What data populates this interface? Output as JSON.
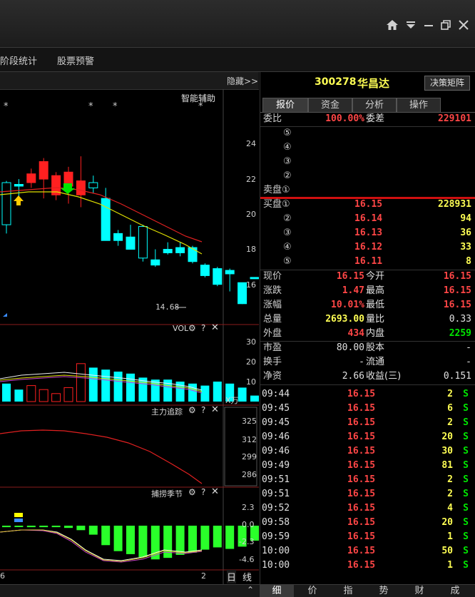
{
  "menu": {
    "items": [
      "阶段统计",
      "股票预警"
    ]
  },
  "chart": {
    "hide_label": "隐藏>>",
    "assist_label": "智能辅助",
    "price_axis": [
      "24",
      "22",
      "20",
      "18",
      "16"
    ],
    "low_label": "14.68",
    "vol_title": "VOL",
    "vol_axis": [
      "30",
      "20",
      "10"
    ],
    "vol_unit": "X万",
    "main_title": "主力追踪",
    "main_axis": [
      "325",
      "312",
      "299",
      "286"
    ],
    "season_title": "捕捞季节",
    "season_axis": [
      "2.3",
      "0.0",
      "-2.3",
      "-4.6"
    ],
    "bottom_left": "6",
    "bottom_right": "2",
    "period_labels": [
      "日",
      "线"
    ],
    "candles": [
      {
        "o": 19.2,
        "c": 21.6,
        "h": 21.7,
        "l": 18.7,
        "col": "cyan"
      },
      {
        "o": 21.4,
        "c": 21.5,
        "h": 21.8,
        "l": 20.6,
        "col": "cyan"
      },
      {
        "o": 21.6,
        "c": 22.1,
        "h": 22.4,
        "l": 21.3,
        "col": "red"
      },
      {
        "o": 21.8,
        "c": 22.8,
        "h": 23.0,
        "l": 20.7,
        "col": "red"
      },
      {
        "o": 20.9,
        "c": 22.0,
        "h": 22.2,
        "l": 20.6,
        "col": "red"
      },
      {
        "o": 21.4,
        "c": 22.2,
        "h": 22.5,
        "l": 20.4,
        "col": "red"
      },
      {
        "o": 20.9,
        "c": 21.7,
        "h": 23.1,
        "l": 20.2,
        "col": "red"
      },
      {
        "o": 21.6,
        "c": 21.3,
        "h": 22.0,
        "l": 21.0,
        "col": "cyan"
      },
      {
        "o": 20.7,
        "c": 18.3,
        "h": 21.3,
        "l": 18.3,
        "col": "cyan"
      },
      {
        "o": 18.7,
        "c": 18.3,
        "h": 18.9,
        "l": 18.0,
        "col": "cyan"
      },
      {
        "o": 17.8,
        "c": 18.5,
        "h": 19.2,
        "l": 17.8,
        "col": "cyan"
      },
      {
        "o": 19.1,
        "c": 17.3,
        "h": 19.2,
        "l": 17.1,
        "col": "cyan"
      },
      {
        "o": 16.9,
        "c": 17.2,
        "h": 17.8,
        "l": 16.8,
        "col": "cyan"
      },
      {
        "o": 17.8,
        "c": 17.6,
        "h": 18.2,
        "l": 17.5,
        "col": "cyan"
      },
      {
        "o": 17.6,
        "c": 17.9,
        "h": 18.2,
        "l": 17.4,
        "col": "cyan"
      },
      {
        "o": 17.9,
        "c": 17.1,
        "h": 18.0,
        "l": 17.0,
        "col": "cyan"
      },
      {
        "o": 16.9,
        "c": 16.3,
        "h": 17.0,
        "l": 16.2,
        "col": "cyan"
      },
      {
        "o": 16.7,
        "c": 15.8,
        "h": 16.8,
        "l": 15.7,
        "col": "cyan"
      },
      {
        "o": 16.6,
        "c": 16.4,
        "h": 16.7,
        "l": 15.4,
        "col": "cyan"
      },
      {
        "o": 15.9,
        "c": 14.7,
        "h": 15.9,
        "l": 14.68,
        "col": "cyan"
      },
      {
        "o": 16.2,
        "c": 16.15,
        "h": 16.2,
        "l": 16.15,
        "col": "cyan"
      }
    ]
  },
  "stock": {
    "code": "300278",
    "name": "华昌达",
    "button": "决策矩阵"
  },
  "tabs": [
    "报价",
    "资金",
    "分析",
    "操作"
  ],
  "commission": {
    "ratio_label": "委比",
    "ratio": "100.00%",
    "diff_label": "委差",
    "diff": "229101"
  },
  "sell": {
    "levels": [
      "⑤",
      "④",
      "③",
      "②"
    ],
    "label1": "卖盘①"
  },
  "buy": [
    {
      "label": "买盘①",
      "price": "16.15",
      "vol": "228931"
    },
    {
      "label": "②",
      "price": "16.14",
      "vol": "94"
    },
    {
      "label": "③",
      "price": "16.13",
      "vol": "36"
    },
    {
      "label": "④",
      "price": "16.12",
      "vol": "33"
    },
    {
      "label": "⑤",
      "price": "16.11",
      "vol": "8"
    }
  ],
  "quote": {
    "now_label": "现价",
    "now": "16.15",
    "open_label": "今开",
    "open": "16.15",
    "chg_label": "涨跌",
    "chg": "1.47",
    "high_label": "最高",
    "high": "16.15",
    "pct_label": "涨幅",
    "pct": "10.01%",
    "low_label": "最低",
    "low": "16.15",
    "vol_label": "总量",
    "vol": "2693.00",
    "vr_label": "量比",
    "vr": "0.33",
    "out_label": "外盘",
    "out": "434",
    "in_label": "内盘",
    "in": "2259"
  },
  "fund": {
    "pe_label": "市盈",
    "pe": "80.00",
    "cap_label": "股本",
    "cap": "-",
    "turn_label": "换手",
    "turn": "-",
    "float_label": "流通",
    "float": "-",
    "nav_label": "净资",
    "nav": "2.66",
    "eps_label": "收益(三)",
    "eps": "0.151"
  },
  "ticks": [
    {
      "time": "09:44",
      "price": "16.15",
      "vol": "2",
      "side": "S"
    },
    {
      "time": "09:45",
      "price": "16.15",
      "vol": "6",
      "side": "S"
    },
    {
      "time": "09:45",
      "price": "16.15",
      "vol": "2",
      "side": "S"
    },
    {
      "time": "09:46",
      "price": "16.15",
      "vol": "20",
      "side": "S"
    },
    {
      "time": "09:46",
      "price": "16.15",
      "vol": "30",
      "side": "S"
    },
    {
      "time": "09:49",
      "price": "16.15",
      "vol": "81",
      "side": "S"
    },
    {
      "time": "09:51",
      "price": "16.15",
      "vol": "2",
      "side": "S"
    },
    {
      "time": "09:51",
      "price": "16.15",
      "vol": "2",
      "side": "S"
    },
    {
      "time": "09:52",
      "price": "16.15",
      "vol": "4",
      "side": "S"
    },
    {
      "time": "09:58",
      "price": "16.15",
      "vol": "20",
      "side": "S"
    },
    {
      "time": "09:59",
      "price": "16.15",
      "vol": "1",
      "side": "S"
    },
    {
      "time": "10:00",
      "price": "16.15",
      "vol": "50",
      "side": "S"
    },
    {
      "time": "10:00",
      "price": "16.15",
      "vol": "1",
      "side": "S"
    }
  ],
  "bottom_tabs": [
    "细",
    "价",
    "指",
    "势",
    "财",
    "成"
  ],
  "colors": {
    "up": "#ff2020",
    "down": "#00ffff",
    "accent_line": "#cc0000"
  }
}
